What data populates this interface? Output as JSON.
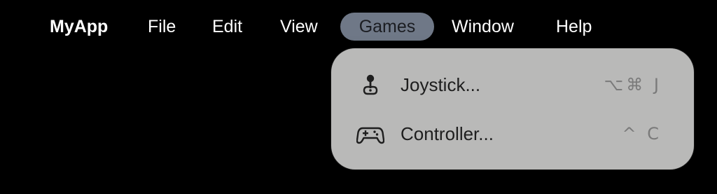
{
  "menubar": {
    "app_name": "MyApp",
    "items": [
      {
        "label": "File"
      },
      {
        "label": "Edit"
      },
      {
        "label": "View"
      },
      {
        "label": "Games",
        "active": true
      },
      {
        "label": "Window"
      },
      {
        "label": "Help"
      }
    ]
  },
  "games_menu": {
    "items": [
      {
        "icon": "joystick-icon",
        "label": "Joystick...",
        "shortcut": "⌥⌘ J"
      },
      {
        "icon": "gamecontroller-icon",
        "label": "Controller...",
        "shortcut": "^ C"
      }
    ]
  },
  "colors": {
    "background": "#000000",
    "menubar_text": "#ffffff",
    "active_menu_highlight": "#6f7887",
    "dropdown_background": "#b9b9b8",
    "dropdown_text": "#1e1e1e",
    "shortcut_text": "#7a7a7a"
  }
}
